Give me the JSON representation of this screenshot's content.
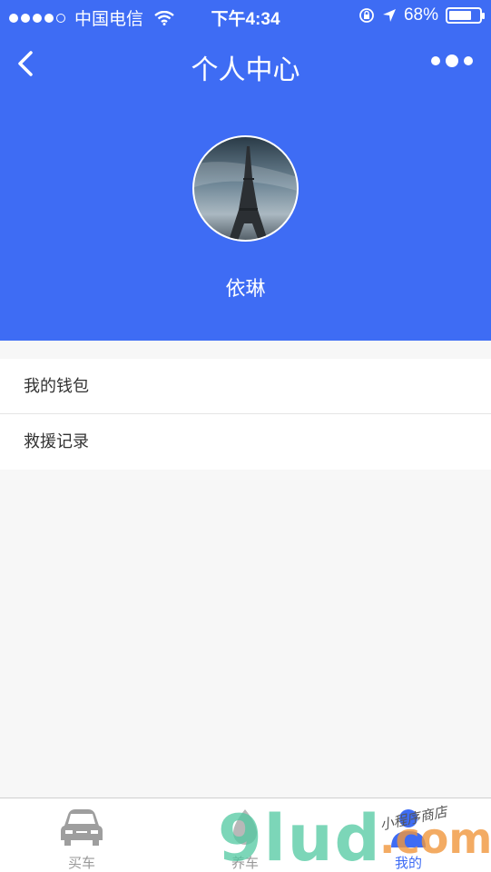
{
  "status_bar": {
    "carrier": "中国电信",
    "time": "下午4:34",
    "battery_percent": "68%",
    "signal_bars_filled": 4,
    "signal_bars_total": 5
  },
  "nav": {
    "title": "个人中心",
    "back_icon": "chevron-left-icon",
    "more_icon": "more-dots-icon"
  },
  "profile": {
    "username": "依琳",
    "avatar_image": "eiffel-tower-photo"
  },
  "menu": {
    "items": [
      {
        "label": "我的钱包"
      },
      {
        "label": "救援记录"
      }
    ]
  },
  "tabbar": {
    "tabs": [
      {
        "label": "买车",
        "icon": "car-icon",
        "active": false
      },
      {
        "label": "养车",
        "icon": "drop-icon",
        "active": false
      },
      {
        "label": "我的",
        "icon": "person-icon",
        "active": true
      }
    ]
  },
  "watermark": {
    "text": "9lud",
    "suffix": ".com",
    "caption": "小程序商店"
  },
  "colors": {
    "accent": "#3e6cf4",
    "background": "#f7f7f7",
    "inactive_tab": "#999999"
  }
}
